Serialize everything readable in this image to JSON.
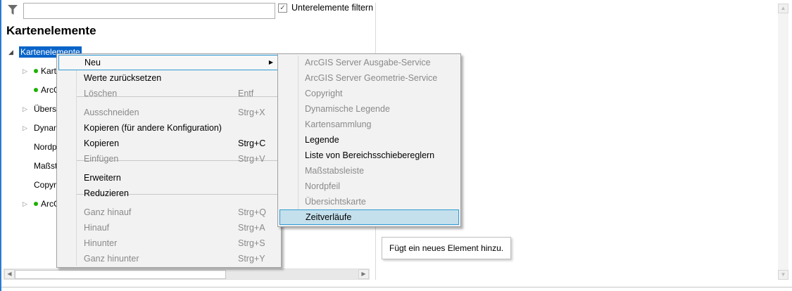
{
  "filter": {
    "placeholder": "",
    "value": "",
    "checkbox_label": "Unterelemente filtern",
    "checked": true
  },
  "title": "Kartenelemente",
  "tree": {
    "root": "Kartenelemente",
    "items": [
      {
        "label": "Karte",
        "expandable": true,
        "dot": true
      },
      {
        "label": "ArcG",
        "expandable": false,
        "dot": true
      },
      {
        "label": "Übersi",
        "expandable": true,
        "dot": false
      },
      {
        "label": "Dynam",
        "expandable": true,
        "dot": false
      },
      {
        "label": "Nordp",
        "expandable": false,
        "dot": false
      },
      {
        "label": "Maßst",
        "expandable": false,
        "dot": false
      },
      {
        "label": "Copyri",
        "expandable": false,
        "dot": false
      },
      {
        "label": "ArcG",
        "expandable": true,
        "dot": true
      }
    ]
  },
  "context_menu": {
    "items": [
      {
        "label": "Neu",
        "shortcut": "",
        "enabled": true,
        "submenu": true
      },
      {
        "label": "Werte zurücksetzen",
        "shortcut": "",
        "enabled": true
      },
      {
        "label": "Löschen",
        "shortcut": "Entf",
        "enabled": false
      },
      {
        "label": "Ausschneiden",
        "shortcut": "Strg+X",
        "enabled": false
      },
      {
        "label": "Kopieren (für andere Konfiguration)",
        "shortcut": "",
        "enabled": true
      },
      {
        "label": "Kopieren",
        "shortcut": "Strg+C",
        "enabled": true
      },
      {
        "label": "Einfügen",
        "shortcut": "Strg+V",
        "enabled": false
      },
      {
        "label": "Erweitern",
        "shortcut": "",
        "enabled": true
      },
      {
        "label": "Reduzieren",
        "shortcut": "",
        "enabled": true
      },
      {
        "label": "Ganz hinauf",
        "shortcut": "Strg+Q",
        "enabled": false
      },
      {
        "label": "Hinauf",
        "shortcut": "Strg+A",
        "enabled": false
      },
      {
        "label": "Hinunter",
        "shortcut": "Strg+S",
        "enabled": false
      },
      {
        "label": "Ganz hinunter",
        "shortcut": "Strg+Y",
        "enabled": false
      }
    ]
  },
  "submenu": {
    "items": [
      {
        "label": "ArcGIS Server Ausgabe-Service",
        "enabled": false
      },
      {
        "label": "ArcGIS Server Geometrie-Service",
        "enabled": false
      },
      {
        "label": "Copyright",
        "enabled": false
      },
      {
        "label": "Dynamische Legende",
        "enabled": false
      },
      {
        "label": "Kartensammlung",
        "enabled": false
      },
      {
        "label": "Legende",
        "enabled": true
      },
      {
        "label": "Liste von Bereichsschiebereglern",
        "enabled": true
      },
      {
        "label": "Maßstabsleiste",
        "enabled": false
      },
      {
        "label": "Nordpfeil",
        "enabled": false
      },
      {
        "label": "Übersichtskarte",
        "enabled": false
      },
      {
        "label": "Zeitverläufe",
        "enabled": true,
        "highlighted": true
      }
    ]
  },
  "tooltip": "Fügt ein neues Element hinzu.",
  "colors": {
    "selection": "#0a64c8",
    "menu_highlight": "#c4e0ec",
    "menu_highlight_border": "#2e9bd6",
    "status_dot": "#1db100"
  }
}
